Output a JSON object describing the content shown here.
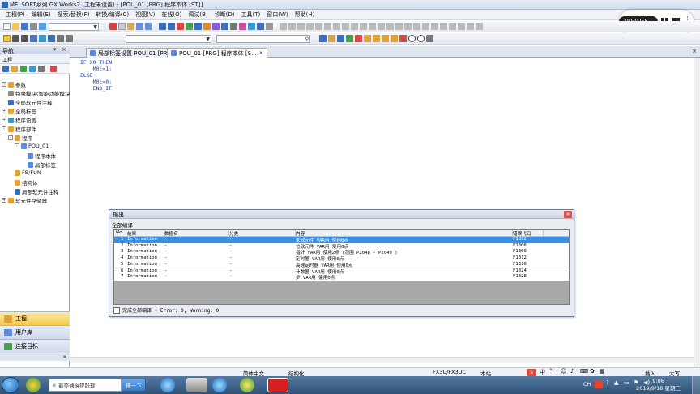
{
  "window": {
    "title": "MELSOFT系列 GX Works2 (工程未设置) - [POU_01 [PRG] 程序本体 [ST]]"
  },
  "menubar": {
    "items": [
      "工程(P)",
      "编辑(E)",
      "搜索/替换(F)",
      "转换/编译(C)",
      "视图(V)",
      "在线(O)",
      "调试(B)",
      "诊断(D)",
      "工具(T)",
      "窗口(W)",
      "帮助(H)"
    ]
  },
  "recording": {
    "time": "00:01:52"
  },
  "navigation": {
    "header": "导航",
    "subheader": "工程",
    "tree": [
      {
        "label": "参数",
        "level": 0,
        "expander": "+"
      },
      {
        "label": "特殊模块(智能功能模块)",
        "level": 0,
        "expander": ""
      },
      {
        "label": "全局软元件注释",
        "level": 0,
        "expander": ""
      },
      {
        "label": "全局标签",
        "level": 0,
        "expander": "+"
      },
      {
        "label": "程序设置",
        "level": 0,
        "expander": "+"
      },
      {
        "label": "程序部件",
        "level": 0,
        "expander": "-"
      },
      {
        "label": "程序",
        "level": 1,
        "expander": "-"
      },
      {
        "label": "POU_01",
        "level": 2,
        "expander": "-"
      },
      {
        "label": "程序本体",
        "level": 3,
        "expander": ""
      },
      {
        "label": "局部标签",
        "level": 3,
        "expander": ""
      },
      {
        "label": "FB/FUN",
        "level": 1,
        "expander": ""
      },
      {
        "label": "结构体",
        "level": 1,
        "expander": ""
      },
      {
        "label": "局部软元件注释",
        "level": 1,
        "expander": ""
      },
      {
        "label": "软元件存储器",
        "level": 0,
        "expander": "+"
      }
    ],
    "bottom_buttons": [
      "工程",
      "用户库",
      "连接目标"
    ]
  },
  "tabs": [
    {
      "label": "局部标签设置 POU_01 [PRG]",
      "active": false
    },
    {
      "label": "POU_01 [PRG] 程序本体 [S...",
      "active": true
    }
  ],
  "editor": {
    "lines": [
      "IF X0 THEN",
      "    M0:=1;",
      "ELSE",
      "    M0:=0;",
      "    END_IF"
    ]
  },
  "output": {
    "title": "输出",
    "subtitle": "全部编译",
    "columns": [
      "No.",
      "结果",
      "数据名",
      "分类",
      "内容",
      "错误代码"
    ],
    "rows": [
      {
        "no": "1",
        "result": "Information",
        "data": "-",
        "category": "-",
        "content": "未软元件 VAR用 使用0点",
        "code": "F1302",
        "selected": true
      },
      {
        "no": "2",
        "result": "Information",
        "data": "-",
        "category": "-",
        "content": "位软元件 VAR用 使用0点",
        "code": "F1306",
        "selected": false
      },
      {
        "no": "3",
        "result": "Information",
        "data": "-",
        "category": "-",
        "content": "指针 VAR用 使用2点 (范围 P2048 - P2049 )",
        "code": "F1309",
        "selected": false
      },
      {
        "no": "4",
        "result": "Information",
        "data": "-",
        "category": "-",
        "content": "定时器 VAR用 使用0点",
        "code": "F1312",
        "selected": false
      },
      {
        "no": "5",
        "result": "Information",
        "data": "-",
        "category": "-",
        "content": "高速定时器 VAR用 使用0点",
        "code": "F1316",
        "selected": false
      },
      {
        "no": "6",
        "result": "Information",
        "data": "-",
        "category": "-",
        "content": "计数器 VAR用 使用0点",
        "code": "F1324",
        "selected": false
      },
      {
        "no": "7",
        "result": "Information",
        "data": "-",
        "category": "-",
        "content": "步 VAR用 使用0点",
        "code": "F1328",
        "selected": false
      }
    ],
    "status": "完成全部编译 - Error: 0, Warning: 0"
  },
  "statusbar": {
    "language": "简体中文",
    "mode": "结构化",
    "cpu": "FX3U/FX3UC",
    "station": "本站",
    "insert": "插入",
    "caps": "大写"
  },
  "taskbar": {
    "search_placeholder": "最美通缉犯跃现",
    "search_button": "搜一下",
    "ime": "CH",
    "time": "9:06",
    "date": "2019/9/18 星期三"
  },
  "colors": {
    "selection": "#3a8ee6",
    "taskbar": "#2f5377",
    "active_nav": "#f7c84c"
  }
}
